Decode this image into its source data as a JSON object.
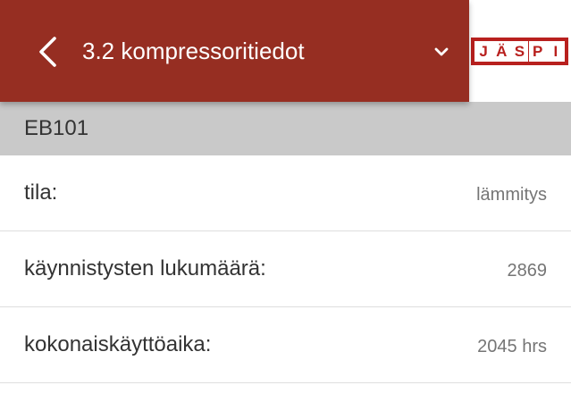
{
  "header": {
    "title": "3.2 kompressoritiedot",
    "back_icon": "chevron-left-icon",
    "dropdown_icon": "chevron-down-icon",
    "color": "#962e22"
  },
  "logo": {
    "letters": [
      "J",
      "Ä",
      "S",
      "P",
      "I"
    ],
    "color": "#b8201e"
  },
  "section": {
    "title": "EB101",
    "color": "#c9c9c9"
  },
  "rows": [
    {
      "label": "tila:",
      "value": "lämmitys"
    },
    {
      "label": "käynnistysten lukumäärä:",
      "value": "2869"
    },
    {
      "label": "kokonaiskäyttöaika:",
      "value": "2045 hrs"
    }
  ]
}
